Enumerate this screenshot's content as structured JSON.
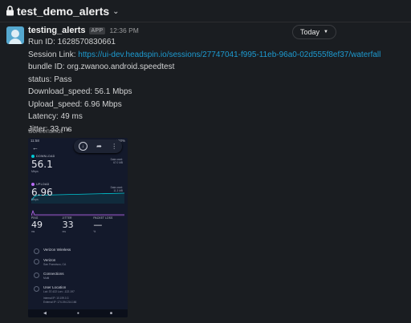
{
  "channel": {
    "name": "test_demo_alerts"
  },
  "message": {
    "sender": "testing_alerts",
    "badge": "APP",
    "time": "12:36 PM",
    "today_label": "Today",
    "lines": {
      "run_id": "Run ID: 1628570830661",
      "session_prefix": "Session Link: ",
      "session_url": "https://ui-dev.headspin.io/sessions/27747041-f995-11eb-96a0-02d555f8ef37/waterfall",
      "bundle_id": "bundle ID: org.zwanoo.android.speedtest",
      "status": "status: Pass",
      "download": "Download_speed: 56.1 Mbps",
      "upload": "Upload_speed: 6.96 Mbps",
      "latency": "Latency: 49 ms",
      "jitter": "Jitter: 33 ms"
    },
    "screenshot_label": "Screenshot"
  },
  "phone": {
    "status_time": "11:58",
    "status_right": "100%",
    "download": {
      "label": "DOWNLOAD",
      "value": "56.1",
      "unit": "Mbps",
      "side1": "Data used:",
      "side2": "67.0 MB",
      "color": "#00c8d4"
    },
    "upload": {
      "label": "UPLOAD",
      "value": "6.96",
      "unit": "Mbps",
      "side1": "Data used:",
      "side2": "11.3 MB",
      "color": "#b86bf5"
    },
    "ping": {
      "label": "PING",
      "value": "49",
      "unit": "ms"
    },
    "jitter": {
      "label": "JITTER",
      "value": "33",
      "unit": "ms"
    },
    "packet_loss": {
      "label": "PACKET LOSS",
      "value": "—",
      "unit": "%"
    },
    "rows": [
      {
        "title": "Verizon Wireless",
        "sub": "",
        "sub2": ""
      },
      {
        "title": "Verizon",
        "sub": "San Francisco, CA",
        "sub2": ""
      },
      {
        "title": "Connections",
        "sub": "Multi",
        "sub2": ""
      },
      {
        "title": "User Location",
        "sub": "Lat: 37.422 Lon: -122.197",
        "sub2": "Internal IP: 10.199.0.3"
      },
      {
        "title": "",
        "sub": "External IP: 174.194.214.166",
        "sub2": ""
      }
    ]
  },
  "colors": {
    "link": "#1d9bd1",
    "background": "#1a1d21"
  }
}
